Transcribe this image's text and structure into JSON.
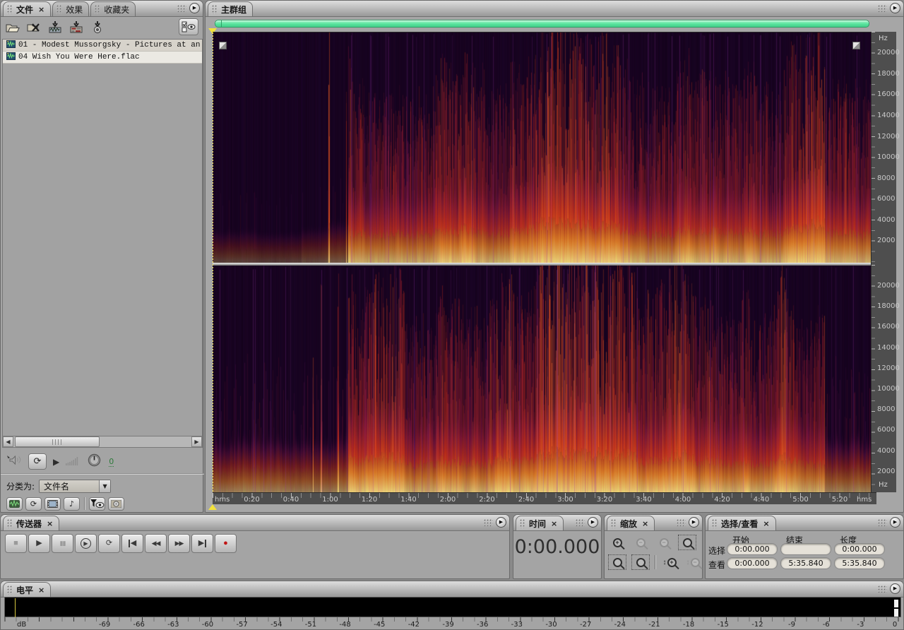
{
  "ui": {
    "close_glyph": "×",
    "menu_glyph": "▶",
    "dropdown_glyph": "▼"
  },
  "files_panel": {
    "tabs": [
      {
        "label": "文件",
        "active": true,
        "closable": true,
        "name": "tab-files"
      },
      {
        "label": "效果",
        "active": false,
        "closable": false,
        "name": "tab-effects"
      },
      {
        "label": "收藏夹",
        "active": false,
        "closable": false,
        "name": "tab-favorites"
      }
    ],
    "files": [
      {
        "name": "01 - Modest Mussorgsky - Pictures at an",
        "selected": false
      },
      {
        "name": "04 Wish You Were Here.flac",
        "selected": true
      }
    ],
    "preview_volume": "0",
    "sort_label": "分类为:",
    "sort_value": "文件名"
  },
  "main_panel": {
    "tab_label": "主群组",
    "freq_unit": "Hz",
    "freq_max": 22050,
    "freq_labels": [
      "20000",
      "18000",
      "16000",
      "14000",
      "12000",
      "10000",
      "8000",
      "6000",
      "4000",
      "2000"
    ],
    "timeline_unit": "hms",
    "duration_sec": 335.84,
    "timeline_labels": [
      {
        "text": "0:20",
        "sec": 20
      },
      {
        "text": "0:40",
        "sec": 40
      },
      {
        "text": "1:00",
        "sec": 60
      },
      {
        "text": "1:20",
        "sec": 80
      },
      {
        "text": "1:40",
        "sec": 100
      },
      {
        "text": "2:00",
        "sec": 120
      },
      {
        "text": "2:20",
        "sec": 140
      },
      {
        "text": "2:40",
        "sec": 160
      },
      {
        "text": "3:00",
        "sec": 180
      },
      {
        "text": "3:20",
        "sec": 200
      },
      {
        "text": "3:40",
        "sec": 220
      },
      {
        "text": "4:00",
        "sec": 240
      },
      {
        "text": "4:20",
        "sec": 260
      },
      {
        "text": "4:40",
        "sec": 280
      },
      {
        "text": "5:00",
        "sec": 300
      },
      {
        "text": "5:20",
        "sec": 320
      }
    ],
    "spectrogram_colors": {
      "background": "#15031d",
      "low": "#ffe08a",
      "mid": "#e03a1a",
      "high": "#5a1060"
    }
  },
  "transport_panel": {
    "tab_label": "传送器",
    "buttons": [
      {
        "name": "stop",
        "glyph": "■",
        "dim": true
      },
      {
        "name": "play",
        "glyph": "▶"
      },
      {
        "name": "pause",
        "glyph": "▮▮",
        "dim": true,
        "small": true
      },
      {
        "name": "play-from-cursor",
        "glyph": "▶",
        "circle": true
      },
      {
        "name": "loop-play",
        "glyph": "⟳"
      },
      {
        "name": "go-to-start",
        "glyph": "◀",
        "bar": "left"
      },
      {
        "name": "rewind",
        "glyph": "◀◀",
        "small": true
      },
      {
        "name": "fast-forward",
        "glyph": "▶▶",
        "small": true
      },
      {
        "name": "go-to-end",
        "glyph": "▶",
        "bar": "right"
      },
      {
        "name": "record",
        "glyph": "●",
        "color": "#c01515"
      }
    ]
  },
  "time_panel": {
    "tab_label": "时间",
    "value": "0:00.000"
  },
  "zoom_panel": {
    "tab_label": "缩放",
    "buttons": [
      {
        "name": "zoom-in-horizontal",
        "sign": "+"
      },
      {
        "name": "zoom-out-horizontal",
        "sign": "−",
        "dim": true
      },
      {
        "name": "zoom-out-full",
        "sign": "−",
        "dim": true
      },
      {
        "name": "zoom-to-selection",
        "sign": "",
        "boxed": true
      },
      {
        "name": "zoom-selection-left",
        "sign": "",
        "boxed": true
      },
      {
        "name": "zoom-selection-right",
        "sign": "",
        "boxed": true
      },
      {
        "name": "zoom-in-vertical",
        "sign": "+",
        "arrow": "↕"
      },
      {
        "name": "zoom-out-vertical",
        "sign": "−",
        "arrow": "↕",
        "dim": true
      }
    ]
  },
  "selection_panel": {
    "tab_label": "选择/查看",
    "columns": [
      "开始",
      "结束",
      "长度"
    ],
    "rows": [
      {
        "label": "选择",
        "values": [
          "0:00.000",
          "",
          "0:00.000"
        ]
      },
      {
        "label": "查看",
        "values": [
          "0:00.000",
          "5:35.840",
          "5:35.840"
        ]
      }
    ]
  },
  "levels_panel": {
    "tab_label": "电平",
    "unit": "dB",
    "ticks": [
      "-69",
      "-66",
      "-63",
      "-60",
      "-57",
      "-54",
      "-51",
      "-48",
      "-45",
      "-42",
      "-39",
      "-36",
      "-33",
      "-30",
      "-27",
      "-24",
      "-21",
      "-18",
      "-15",
      "-12",
      "-9",
      "-6",
      "-3",
      "0"
    ]
  }
}
